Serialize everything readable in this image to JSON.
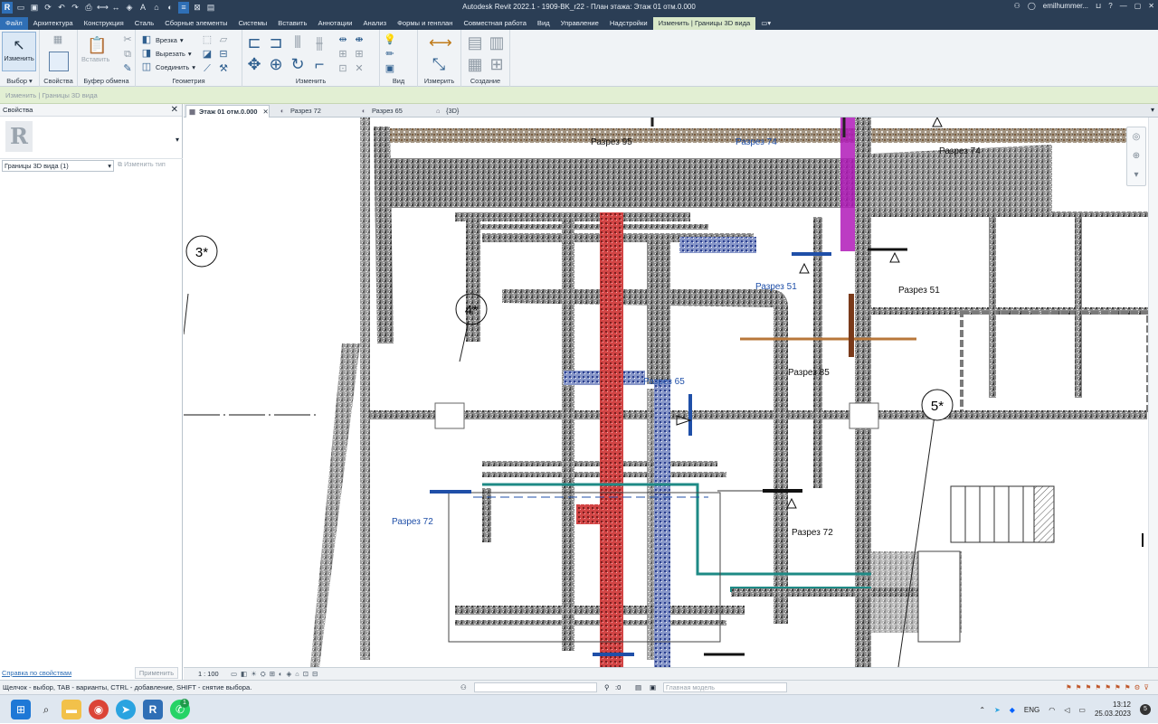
{
  "window": {
    "title": "Autodesk Revit 2022.1 - 1909-BK_r22 - План этажа: Этаж 01 отм.0.000",
    "user": "emilhummer...",
    "quick_access_icons": [
      "revit-logo-icon",
      "open-icon",
      "save-icon",
      "sync-icon",
      "undo-icon",
      "redo-icon",
      "print-icon",
      "measure-icon",
      "dimension-icon",
      "tag-icon",
      "text-icon",
      "view-3d-icon",
      "section-icon",
      "thin-lines-icon",
      "close-hidden-icon",
      "switch-windows-icon"
    ]
  },
  "menu": {
    "tabs": [
      "Файл",
      "Архитектура",
      "Конструкция",
      "Сталь",
      "Сборные элементы",
      "Системы",
      "Вставить",
      "Аннотации",
      "Анализ",
      "Формы и генплан",
      "Совместная работа",
      "Вид",
      "Управление",
      "Надстройки",
      "Изменить | Границы 3D вида"
    ],
    "active_tab": "Изменить | Границы 3D вида"
  },
  "ribbon": {
    "modify_label": "Изменить",
    "paste_label": "Вставить",
    "cut_notch_label": "Врезка",
    "cut_label": "Вырезать",
    "join_label": "Соединить",
    "panels": {
      "select": "Выбор",
      "properties": "Свойства",
      "clipboard": "Буфер обмена",
      "geometry": "Геометрия",
      "modify": "Изменить",
      "view": "Вид",
      "measure": "Измерить",
      "create": "Создание"
    }
  },
  "context_bar": "Изменить | Границы 3D вида",
  "properties_panel": {
    "title": "Свойства",
    "type_selector": "Границы 3D вида (1)",
    "edit_type": "Изменить тип",
    "help_link": "Справка по свойствам",
    "apply": "Применить"
  },
  "view_tabs": [
    {
      "label": "Этаж 01 отм.0.000",
      "active": true,
      "icon": "floor-plan-icon"
    },
    {
      "label": "Разрез 72",
      "active": false,
      "icon": "section-view-icon"
    },
    {
      "label": "Разрез 65",
      "active": false,
      "icon": "section-view-icon"
    },
    {
      "label": "{3D}",
      "active": false,
      "icon": "view-3d-icon"
    }
  ],
  "drawing": {
    "grid_bubbles": [
      "3*",
      "4*",
      "5*"
    ],
    "section_labels_blue": [
      "Разрез 95",
      "Разрез 74",
      "Разрез 51",
      "Разрез 65",
      "Разрез 72"
    ],
    "section_labels_black": [
      "Разрез 74",
      "Разрез 51",
      "Разрез 85",
      "Разрез 72"
    ],
    "colors": {
      "point_cloud": "#6b6b6b",
      "red_duct": "#d23a3a",
      "blue_duct": "#3d5fb8",
      "magenta_pipe": "#b01ab8",
      "teal_pipe": "#1e8a85",
      "orange_pipe": "#b8773a",
      "section_blue": "#1f4fa8"
    }
  },
  "view_control": {
    "scale": "1 : 100"
  },
  "status": {
    "message": "Щелчок - выбор, TAB - варианты, CTRL - добавление, SHIFT - снятие выбора.",
    "coord": ":0",
    "model": "Главная модель"
  },
  "taskbar": {
    "apps": [
      "windows-start-icon",
      "search-icon",
      "file-explorer-icon",
      "chrome-icon",
      "telegram-icon",
      "revit-icon",
      "whatsapp-icon"
    ],
    "whatsapp_badge": "1",
    "language": "ENG",
    "time": "13:12",
    "date": "25.03.2023",
    "notification_count": "5"
  }
}
